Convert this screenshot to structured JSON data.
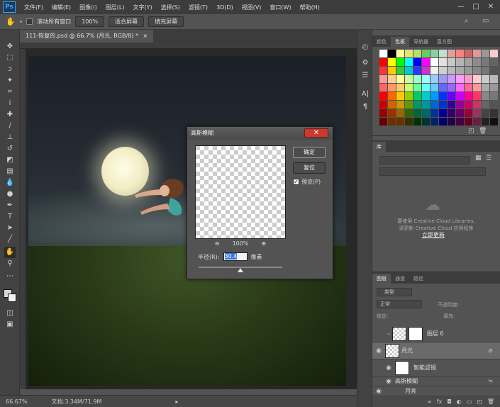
{
  "app": {
    "logo": "Ps"
  },
  "menu": [
    "文件(F)",
    "编辑(E)",
    "图像(I)",
    "图层(L)",
    "文字(Y)",
    "选择(S)",
    "滤镜(T)",
    "3D(D)",
    "视图(V)",
    "窗口(W)",
    "帮助(H)"
  ],
  "window_controls": {
    "minimize": "—",
    "maximize": "□",
    "close": "✕"
  },
  "options": {
    "scroll_all": "滚动所有窗口",
    "zoom_value": "100%",
    "fit_screen": "适合屏幕",
    "fill_screen": "填充屏幕"
  },
  "document": {
    "tab_title": "111-恢复的.psd @ 66.7% (月光, RGB/8) *",
    "tab_close": "×"
  },
  "status": {
    "zoom": "66.67%",
    "doc_info": "文档:3.34M/71.9M",
    "arrow": "▸"
  },
  "color_panel": {
    "tabs": [
      "颜色",
      "色板",
      "导航器",
      "直方图"
    ],
    "active_tab": 1
  },
  "library_panel": {
    "title": "库",
    "message1": "要使用 Creative Cloud Libraries,",
    "message2": "请更新 Creative Cloud 应用程序",
    "update_link": "立即更新"
  },
  "layers_panel": {
    "tabs": [
      "图层",
      "通道",
      "路径"
    ],
    "filter_kind": "类型",
    "blend_mode": "正常",
    "opacity_label": "不透明度:",
    "lock_label": "锁定:",
    "fill_label": "填充:",
    "layers": [
      {
        "name": "图层 6",
        "visible": false
      },
      {
        "name": "月光",
        "visible": true
      },
      {
        "name": "智能滤镜",
        "visible": true
      },
      {
        "name": "高斯模糊",
        "visible": true
      },
      {
        "name": "月亮",
        "visible": true
      }
    ]
  },
  "dialog": {
    "title": "高斯模糊",
    "close": "✕",
    "ok": "确定",
    "reset": "复位",
    "preview_label": "预览(P)",
    "preview_checked": true,
    "zoom_out": "⊖",
    "zoom_level": "100%",
    "zoom_in": "⊕",
    "radius_label": "半径(R):",
    "radius_value": "30.4",
    "radius_unit": "像素",
    "radius_fraction": 0.5
  },
  "swatch_colors": [
    "#ffffff",
    "#000000",
    "#ffff99",
    "#e3e374",
    "#b1e074",
    "#66cc66",
    "#8bd1a0",
    "#c0e0d0",
    "#e0a0a0",
    "#ff8080",
    "#cc6666",
    "#dd9999",
    "#999999",
    "#ffcccc",
    "#ff0000",
    "#ffff00",
    "#00ff00",
    "#00ffff",
    "#0000ff",
    "#ff00ff",
    "#ffffff",
    "#e0e0e0",
    "#c8c8c8",
    "#b4b4b4",
    "#a0a0a0",
    "#8c8c8c",
    "#787878",
    "#646464",
    "#ff3333",
    "#ffcc00",
    "#33cc33",
    "#00cccc",
    "#3333ff",
    "#cc33cc",
    "#f0f0f0",
    "#d0d0d0",
    "#bbbbbb",
    "#aaaaaa",
    "#999999",
    "#888888",
    "#777777",
    "#555555",
    "#ff9999",
    "#ffcc99",
    "#ffff99",
    "#ccff99",
    "#99ffcc",
    "#99ffff",
    "#99ccff",
    "#9999ff",
    "#cc99ff",
    "#ff99ff",
    "#ff99cc",
    "#ffcccc",
    "#cccccc",
    "#bbbbbb",
    "#ff6666",
    "#ff9966",
    "#ffcc66",
    "#ccff66",
    "#66ff99",
    "#66ffff",
    "#66ccff",
    "#6666ff",
    "#9966ff",
    "#ff66ff",
    "#ff6699",
    "#ff9999",
    "#aaaaaa",
    "#999999",
    "#ff0000",
    "#ff6600",
    "#ffcc00",
    "#99cc00",
    "#00cc66",
    "#00cccc",
    "#0099ff",
    "#0033ff",
    "#6600ff",
    "#cc00ff",
    "#ff0099",
    "#ff3366",
    "#888888",
    "#777777",
    "#cc0000",
    "#cc6600",
    "#cc9900",
    "#669900",
    "#009966",
    "#009999",
    "#0066cc",
    "#0033cc",
    "#330099",
    "#990099",
    "#cc0066",
    "#cc3366",
    "#666666",
    "#555555",
    "#990000",
    "#993300",
    "#996600",
    "#336600",
    "#006633",
    "#006666",
    "#003399",
    "#000099",
    "#330066",
    "#660066",
    "#990033",
    "#993366",
    "#444444",
    "#333333",
    "#660000",
    "#663300",
    "#663300",
    "#333300",
    "#003300",
    "#003333",
    "#002266",
    "#000066",
    "#220044",
    "#440044",
    "#660022",
    "#662244",
    "#222222",
    "#111111"
  ]
}
